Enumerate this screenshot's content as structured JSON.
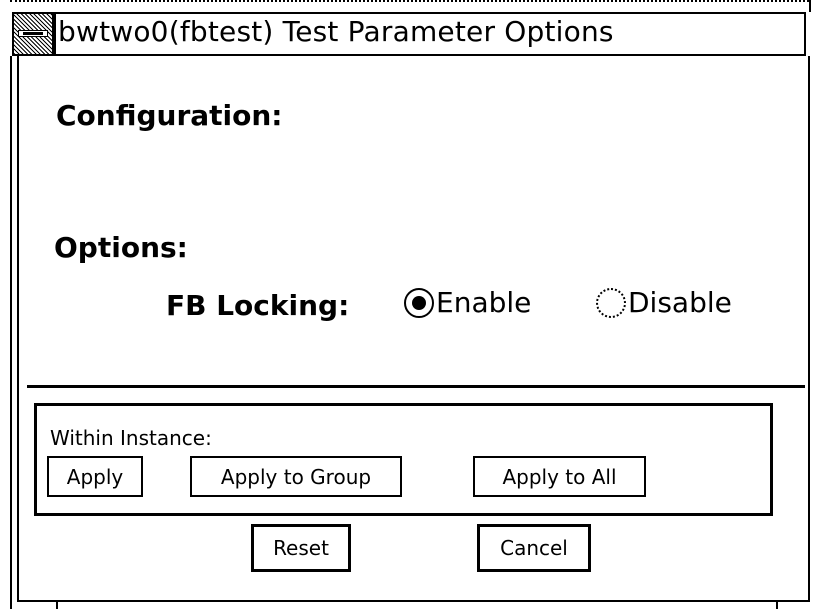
{
  "window": {
    "title": "bwtwo0(fbtest) Test Parameter Options"
  },
  "configuration": {
    "heading": "Configuration:"
  },
  "options": {
    "heading": "Options:",
    "fb_locking": {
      "label": "FB Locking:",
      "choices": [
        {
          "label": "Enable",
          "selected": true
        },
        {
          "label": "Disable",
          "selected": false
        }
      ]
    }
  },
  "instance": {
    "label": "Within Instance:",
    "buttons": {
      "apply": "Apply",
      "apply_group": "Apply to Group",
      "apply_all": "Apply to All"
    }
  },
  "footer": {
    "reset": "Reset",
    "cancel": "Cancel"
  },
  "icons": {
    "window_menu": "window-menu-icon"
  },
  "colors": {
    "foreground": "#000000",
    "background": "#ffffff"
  }
}
